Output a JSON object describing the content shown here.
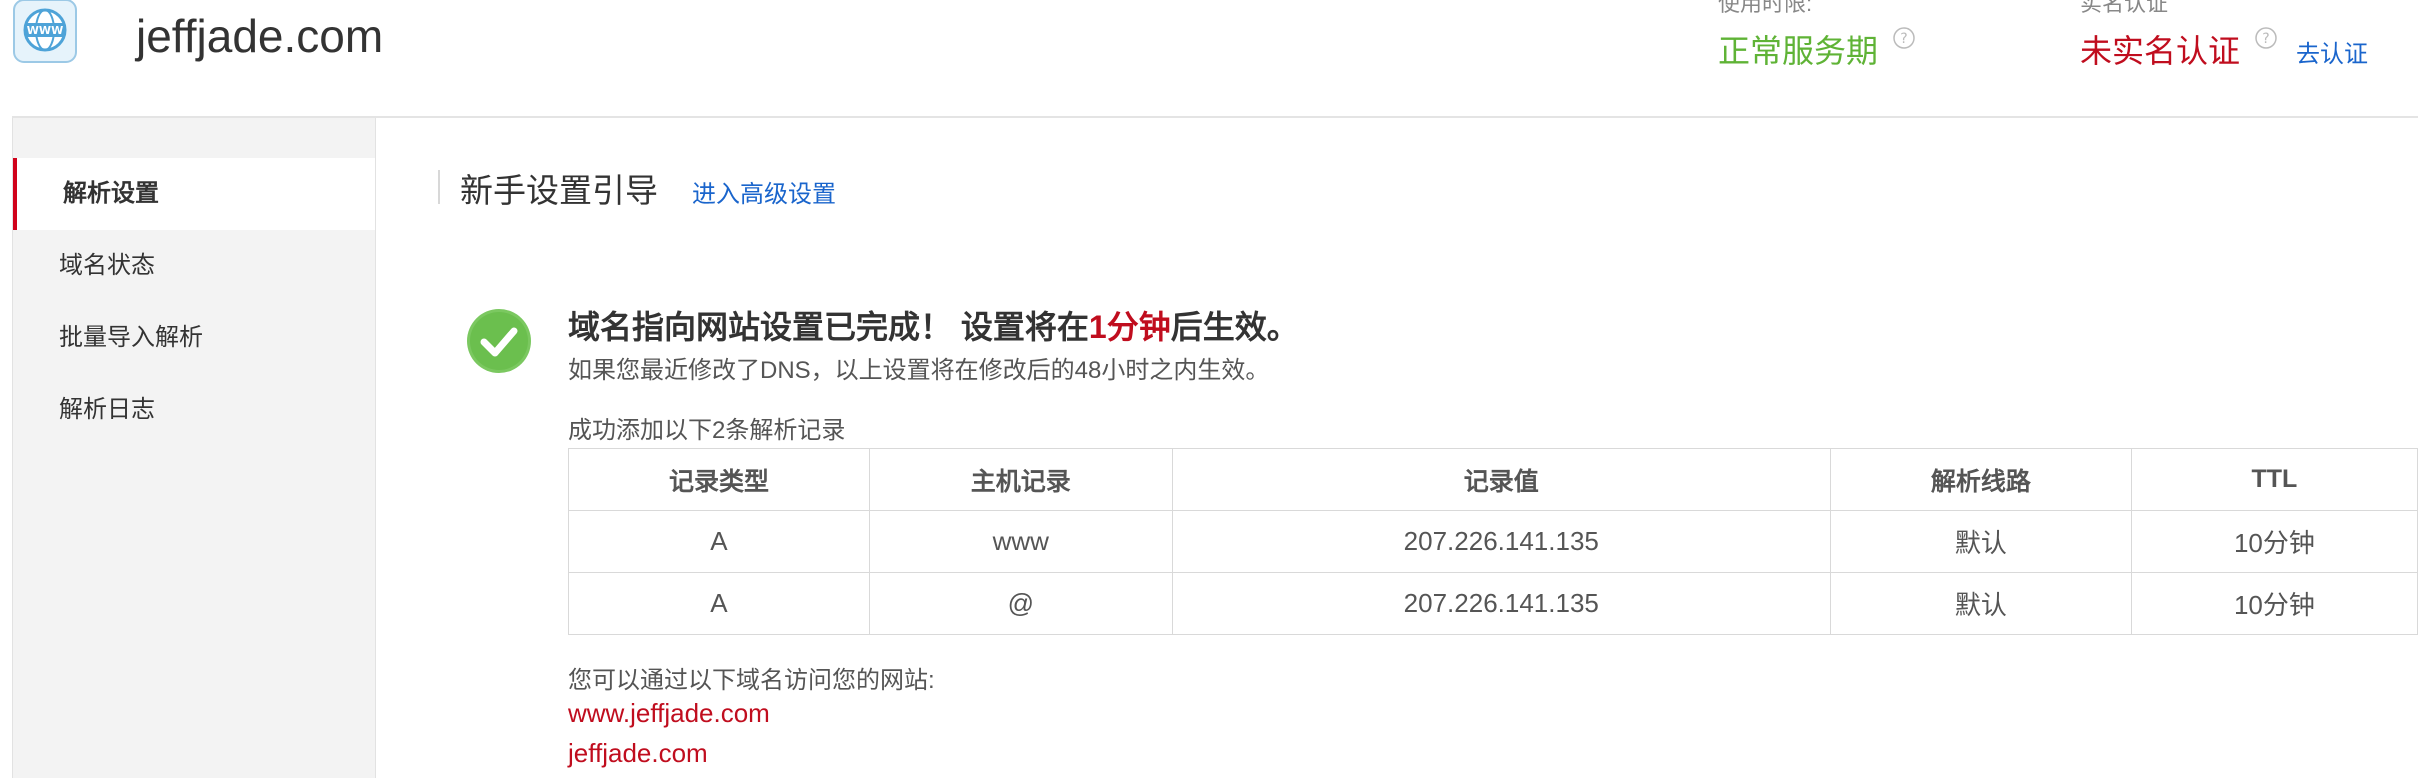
{
  "header": {
    "domain": "jeffjade.com",
    "logo_icon": "www-globe-icon",
    "service": {
      "label": "使用时限:",
      "value": "正常服务期",
      "color": "#5fb336"
    },
    "realname": {
      "label": "实名认证",
      "value": "未实名认证",
      "color": "#c00d1e",
      "action": "去认证"
    }
  },
  "sidebar": {
    "items": [
      {
        "label": "解析设置",
        "active": true
      },
      {
        "label": "域名状态",
        "active": false
      },
      {
        "label": "批量导入解析",
        "active": false
      },
      {
        "label": "解析日志",
        "active": false
      }
    ]
  },
  "main": {
    "guide_title": "新手设置引导",
    "advanced_link": "进入高级设置",
    "success": {
      "heading_prefix": "域名指向网站设置已完成！  设置将在",
      "heading_highlight": "1分钟",
      "heading_suffix": "后生效。",
      "subtext": "如果您最近修改了DNS，以上设置将在修改后的48小时之内生效。"
    },
    "records_caption": "成功添加以下2条解析记录",
    "table": {
      "headers": [
        "记录类型",
        "主机记录",
        "记录值",
        "解析线路",
        "TTL"
      ],
      "rows": [
        [
          "A",
          "www",
          "207.226.141.135",
          "默认",
          "10分钟"
        ],
        [
          "A",
          "@",
          "207.226.141.135",
          "默认",
          "10分钟"
        ]
      ]
    },
    "visit_caption": "您可以通过以下域名访问您的网站:",
    "sites": [
      "www.jeffjade.com",
      "jeffjade.com"
    ]
  }
}
